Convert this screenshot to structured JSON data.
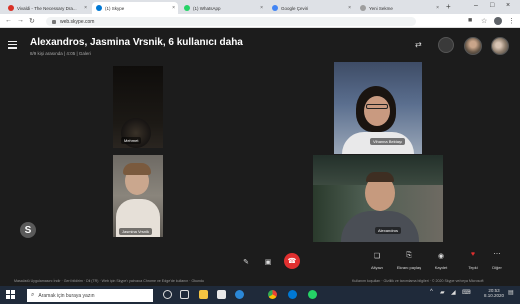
{
  "browser": {
    "tabs": [
      {
        "label": "Vivaldi - The Necessary Dra...",
        "color": "#d93025"
      },
      {
        "label": "(1) Skype",
        "color": "#0078d4"
      },
      {
        "label": "(1) WhatsApp",
        "color": "#25d366"
      },
      {
        "label": "Google Çeviri",
        "color": "#4285f4"
      },
      {
        "label": "Yeni Sekme",
        "color": "#9e9e9e"
      }
    ],
    "new_tab": "+",
    "url": "web.skype.com"
  },
  "call": {
    "title": "Alexandros, Jasmina Vrsnik, 6 kullanıcı daha",
    "subtitle": "8/9 kişi arasında | 4:05 | Galeri",
    "participants": [
      {
        "name": "Mehmet"
      },
      {
        "name": "Vihanna Bektaşı"
      },
      {
        "name": "Jasmina Vrsnik"
      },
      {
        "name": "Alexandros"
      }
    ]
  },
  "controls": {
    "subtitles": "Altyazı",
    "share_screen": "Ekranı paylaş",
    "record": "Kaydet",
    "react": "Tepki",
    "more": "Diğer"
  },
  "footer": {
    "left": "Masaüstü Uygulamasını İndir  ·  Geri bildirim  ·  Dil (TR)  ·  Web için Skype'ı yalnızca Chrome ve Edge'de kullanın  ·  Okundu",
    "right": "Kullanım koşulları  ·  Gizlilik ve tanımlama bilgileri  ·  © 2020 Skype ve/veya Microsoft"
  },
  "taskbar": {
    "search_placeholder": "Aramak için buraya yazın",
    "time": "20:53",
    "date": "8.10.2020"
  },
  "colors": {
    "hangup": "#e02f2f",
    "accent": "#0078d4"
  }
}
